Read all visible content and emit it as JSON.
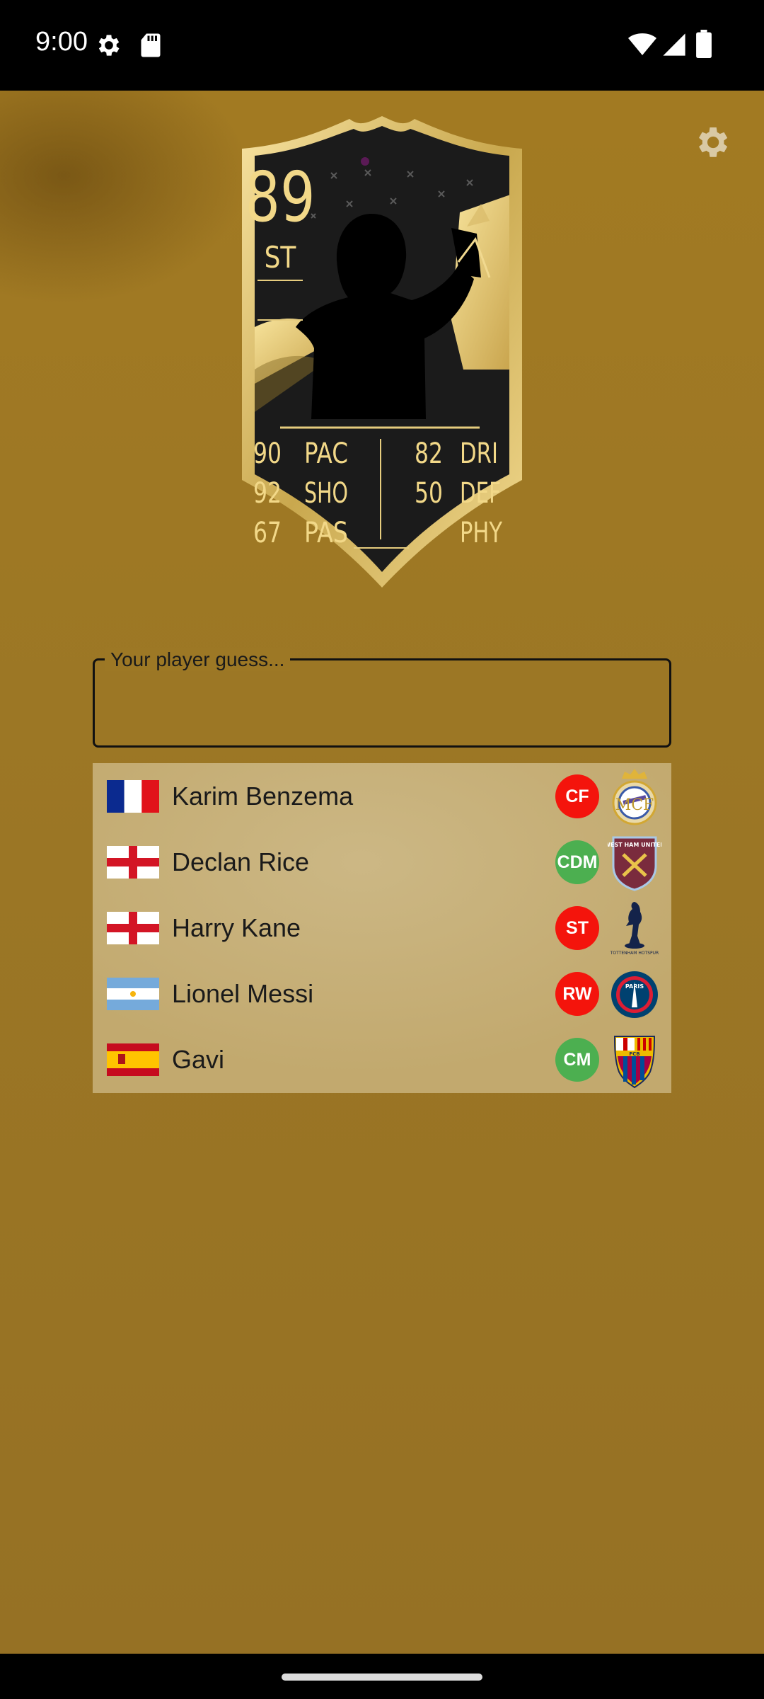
{
  "status_bar": {
    "time": "9:00"
  },
  "card": {
    "rating": "89",
    "position": "ST",
    "stats_left": [
      {
        "value": "90",
        "label": "PAC"
      },
      {
        "value": "92",
        "label": "SHO"
      },
      {
        "value": "67",
        "label": "PAS"
      }
    ],
    "stats_right": [
      {
        "value": "82",
        "label": "DRI"
      },
      {
        "value": "50",
        "label": "DEF"
      },
      {
        "value": "",
        "label": "PHY"
      }
    ]
  },
  "guess": {
    "label": "Your player guess...",
    "value": ""
  },
  "suggestions": [
    {
      "name": "Karim Benzema",
      "country": "France",
      "position": "CF",
      "position_color": "#f4140c",
      "club": "Real Madrid"
    },
    {
      "name": "Declan Rice",
      "country": "England",
      "position": "CDM",
      "position_color": "#4caf50",
      "club": "West Ham United"
    },
    {
      "name": "Harry Kane",
      "country": "England",
      "position": "ST",
      "position_color": "#f4140c",
      "club": "Tottenham Hotspur"
    },
    {
      "name": "Lionel Messi",
      "country": "Argentina",
      "position": "RW",
      "position_color": "#f4140c",
      "club": "Paris Saint-Germain"
    },
    {
      "name": "Gavi",
      "country": "Spain",
      "position": "CM",
      "position_color": "#4caf50",
      "club": "FC Barcelona"
    }
  ],
  "club_badge_text": {
    "west_ham": "WEST HAM UNITED",
    "tottenham": "TOTTENHAM HOTSPUR",
    "psg": "PARIS",
    "barcelona": "FCB"
  },
  "icons": {
    "settings": "gear-icon",
    "status": [
      "gear-icon",
      "sd-card-icon",
      "wifi-icon",
      "signal-icon",
      "battery-icon"
    ]
  },
  "colors": {
    "background": "#a27a22",
    "card_gold": "#f2d888",
    "card_dark": "#1c1c1c",
    "suggestion_bg": "#c2a96e"
  }
}
